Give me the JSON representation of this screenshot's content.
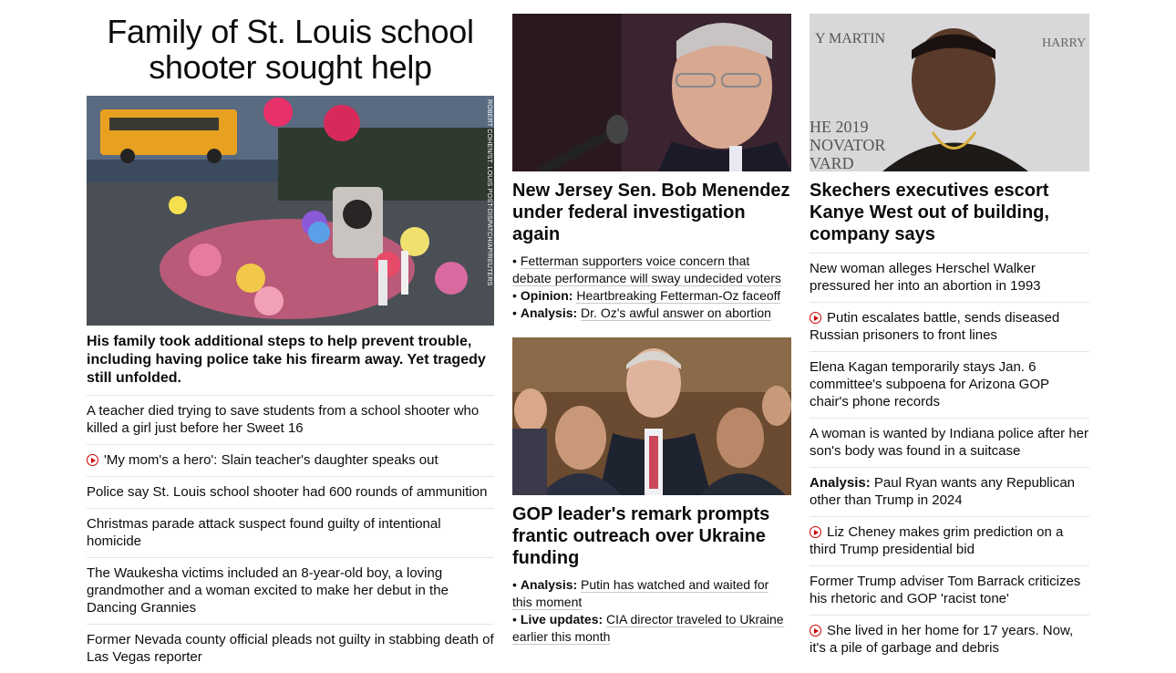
{
  "lead": {
    "headline": "Family of St. Louis school shooter sought help",
    "image_credit": "ROBERT COHEN/ST. LOUIS POST-DISPATCH/AP/REUTERS",
    "description": "His family took additional steps to help prevent trouble, including having police take his firearm away. Yet tragedy still unfolded.",
    "stories": [
      {
        "text": "A teacher died trying to save students from a school shooter who killed a girl just before her Sweet 16",
        "video": false
      },
      {
        "text": "'My mom's a hero': Slain teacher's daughter speaks out",
        "video": true
      },
      {
        "text": "Police say St. Louis school shooter had 600 rounds of ammunition",
        "video": false
      },
      {
        "text": "Christmas parade attack suspect found guilty of intentional homicide",
        "video": false
      },
      {
        "text": "The Waukesha victims included an 8-year-old boy, a loving grandmother and a woman excited to make her debut in the Dancing Grannies",
        "video": false
      },
      {
        "text": "Former Nevada county official pleads not guilty in stabbing death of Las Vegas reporter",
        "video": false
      }
    ]
  },
  "menendez": {
    "title": "New Jersey Sen. Bob Menendez under federal investigation again",
    "bullets": [
      {
        "prefix": "",
        "text": "Fetterman supporters voice concern that debate performance will sway undecided voters"
      },
      {
        "prefix": "Opinion:",
        "text": "Heartbreaking Fetterman-Oz faceoff"
      },
      {
        "prefix": "Analysis:",
        "text": "Dr. Oz's awful answer on abortion"
      }
    ]
  },
  "gop": {
    "title": "GOP leader's remark prompts frantic outreach over Ukraine funding",
    "bullets": [
      {
        "prefix": "Analysis:",
        "text": "Putin has watched and waited for this moment"
      },
      {
        "prefix": "Live updates:",
        "text": "CIA director traveled to Ukraine earlier this month"
      }
    ]
  },
  "kanye": {
    "image_text": {
      "top_left": "Y MARTIN",
      "top_right": "HARRY",
      "bottom_left": "HE 2019\nNOVATOR\nVARD"
    },
    "title": "Skechers executives escort Kanye West out of building, company says",
    "stories": [
      {
        "prefix": "",
        "text": "New woman alleges Herschel Walker pressured her into an abortion in 1993",
        "video": false
      },
      {
        "prefix": "",
        "text": "Putin escalates battle, sends diseased Russian prisoners to front lines",
        "video": true
      },
      {
        "prefix": "",
        "text": "Elena Kagan temporarily stays Jan. 6 committee's subpoena for Arizona GOP chair's phone records",
        "video": false
      },
      {
        "prefix": "",
        "text": "A woman is wanted by Indiana police after her son's body was found in a suitcase",
        "video": false
      },
      {
        "prefix": "Analysis:",
        "text": "Paul Ryan wants any Republican other than Trump in 2024",
        "video": false
      },
      {
        "prefix": "",
        "text": "Liz Cheney makes grim prediction on a third Trump presidential bid",
        "video": true
      },
      {
        "prefix": "",
        "text": "Former Trump adviser Tom Barrack criticizes his rhetoric and GOP 'racist tone'",
        "video": false
      },
      {
        "prefix": "",
        "text": "She lived in her home for 17 years. Now, it's a pile of garbage and debris",
        "video": true
      }
    ]
  }
}
